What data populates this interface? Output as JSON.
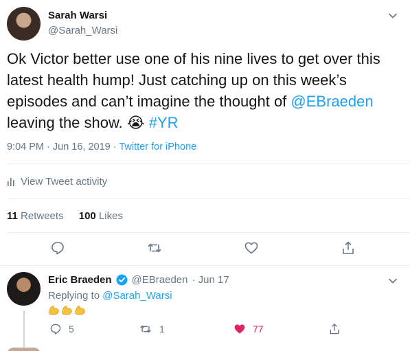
{
  "tweet": {
    "name": "Sarah Warsi",
    "handle": "@Sarah_Warsi",
    "text_lines": [
      "Ok Victor better use one of his nine lives to get over this",
      "latest health hump! Just catching up on this week’s",
      "episodes and can’t imagine the thought of "
    ],
    "mention": "@EBraeden",
    "text_end": " leaving the show. ",
    "emoji": "😭",
    "hashtag": "#YR",
    "timestamp": "9:04 PM · Jun 16, 2019",
    "separator": " · ",
    "source": "Twitter for iPhone",
    "view_activity": "View Tweet activity",
    "retweets_count": "11",
    "retweets_label": "Retweets",
    "likes_count": "100",
    "likes_label": "Likes"
  },
  "reply": {
    "name": "Eric Braeden",
    "handle": "@EBraeden",
    "date": "· Jun 17",
    "replying_prefix": "Replying to ",
    "replying_to": "@Sarah_Warsi",
    "reply_count": "5",
    "retweet_count": "1",
    "like_count": "77"
  },
  "colors": {
    "link": "#1da1f2",
    "muted": "#657786",
    "like": "#e0245e",
    "verified": "#1da1f2"
  },
  "icons": [
    "chevron-down-icon",
    "chart-icon",
    "reply-icon",
    "retweet-icon",
    "like-icon",
    "share-icon",
    "verified-icon",
    "muscle-emoji"
  ]
}
